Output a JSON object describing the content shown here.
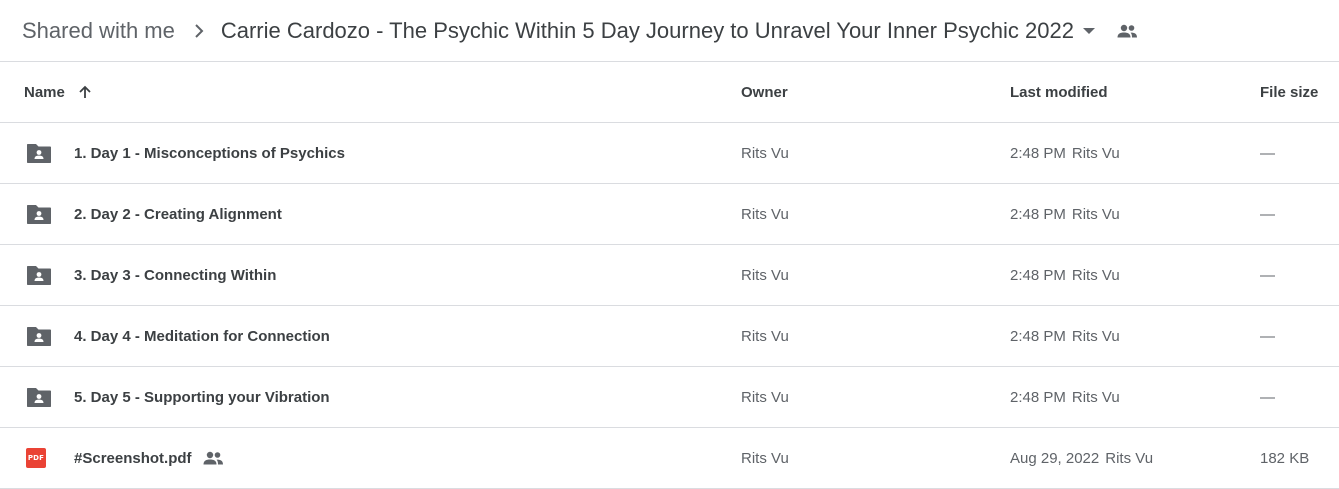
{
  "breadcrumb": {
    "root": "Shared with me",
    "current": "Carrie Cardozo - The Psychic Within 5 Day Journey to Unravel Your Inner Psychic 2022"
  },
  "columns": {
    "name": "Name",
    "owner": "Owner",
    "modified": "Last modified",
    "size": "File size"
  },
  "files": [
    {
      "type": "shared-folder",
      "name": "1. Day 1 - Misconceptions of Psychics",
      "owner": "Rits Vu",
      "modified": "2:48 PM",
      "modified_by": "Rits Vu",
      "size": "—"
    },
    {
      "type": "shared-folder",
      "name": "2. Day 2 - Creating Alignment",
      "owner": "Rits Vu",
      "modified": "2:48 PM",
      "modified_by": "Rits Vu",
      "size": "—"
    },
    {
      "type": "shared-folder",
      "name": "3. Day 3 - Connecting Within",
      "owner": "Rits Vu",
      "modified": "2:48 PM",
      "modified_by": "Rits Vu",
      "size": "—"
    },
    {
      "type": "shared-folder",
      "name": "4. Day 4 - Meditation for Connection",
      "owner": "Rits Vu",
      "modified": "2:48 PM",
      "modified_by": "Rits Vu",
      "size": "—"
    },
    {
      "type": "shared-folder",
      "name": "5. Day 5 - Supporting your Vibration",
      "owner": "Rits Vu",
      "modified": "2:48 PM",
      "modified_by": "Rits Vu",
      "size": "—"
    },
    {
      "type": "pdf",
      "name": "#Screenshot.pdf",
      "icon_label": "PDF",
      "shared": true,
      "owner": "Rits Vu",
      "modified": "Aug 29, 2022",
      "modified_by": "Rits Vu",
      "size": "182 KB"
    }
  ],
  "colors": {
    "text": "#3c4043",
    "secondary_text": "#5f6368",
    "divider": "#dadce0",
    "pdf_red": "#ea4335"
  }
}
